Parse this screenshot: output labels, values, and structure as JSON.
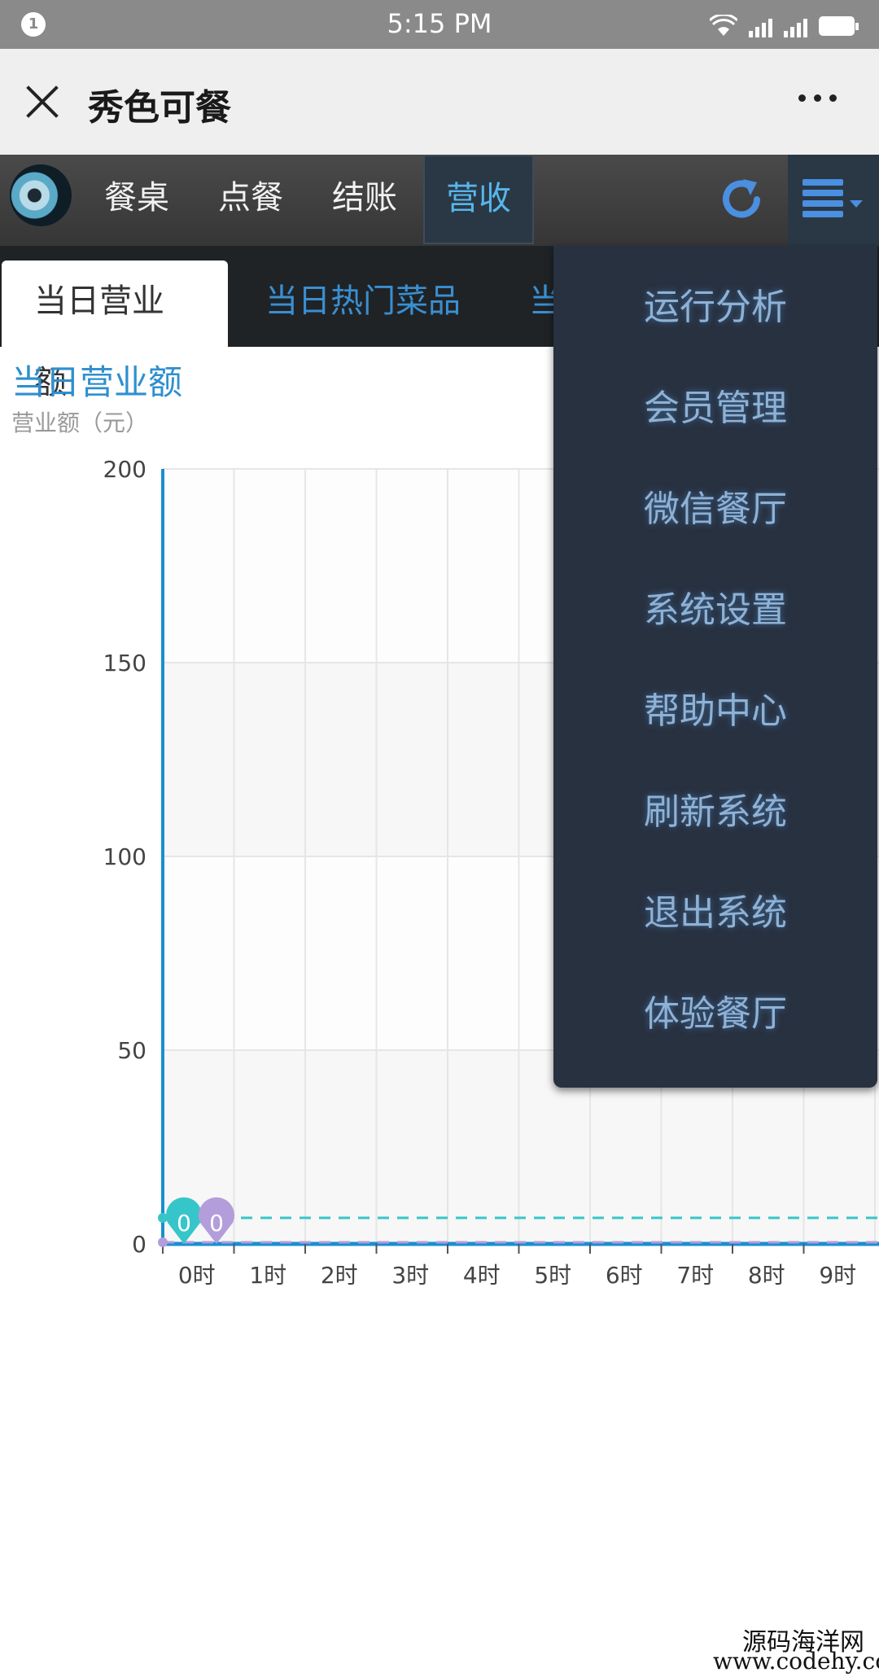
{
  "status_bar": {
    "notification_count": "1",
    "time": "5:15 PM"
  },
  "title_bar": {
    "title": "秀色可餐"
  },
  "nav": {
    "items": [
      "餐桌",
      "点餐",
      "结账",
      "营收"
    ],
    "active_index": 3,
    "refresh_icon": "refresh-icon",
    "menu_icon": "menu-icon"
  },
  "tabs": [
    "当日营业额",
    "当日热门菜品",
    "当"
  ],
  "chart_title": "当日营业额",
  "chart_subtitle": "营业额（元）",
  "chart_data": {
    "type": "line",
    "title": "当日营业额",
    "ylabel": "营业额（元）",
    "ylim": [
      0,
      200
    ],
    "yticks": [
      0,
      50,
      100,
      150,
      200
    ],
    "categories": [
      "0时",
      "1时",
      "2时",
      "3时",
      "4时",
      "5时",
      "6时",
      "7时",
      "8时",
      "9时"
    ],
    "series": [
      {
        "color": "#36c6c9",
        "values": [
          0,
          0,
          0,
          0,
          0,
          0,
          0,
          0,
          0,
          0
        ],
        "marker_label": "0"
      },
      {
        "color": "#b39ddb",
        "values": [
          0,
          0,
          0,
          0,
          0,
          0,
          0,
          0,
          0,
          0
        ],
        "marker_label": "0"
      }
    ],
    "grid": true
  },
  "dropdown_menu": {
    "items": [
      "运行分析",
      "会员管理",
      "微信餐厅",
      "系统设置",
      "帮助中心",
      "刷新系统",
      "退出系统",
      "体验餐厅"
    ]
  },
  "watermark": {
    "line1": "源码海洋网",
    "line2": "www.codehy.com"
  }
}
